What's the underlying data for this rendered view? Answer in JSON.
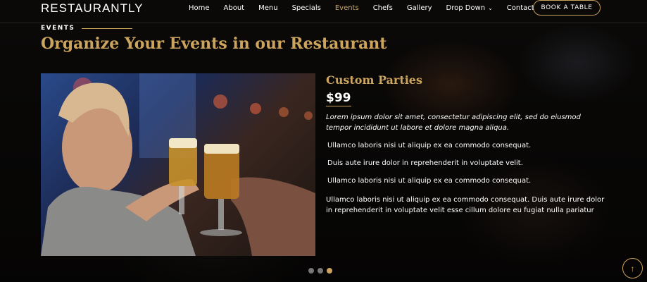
{
  "header": {
    "logo": "RESTAURANTLY",
    "nav": [
      {
        "label": "Home"
      },
      {
        "label": "About"
      },
      {
        "label": "Menu"
      },
      {
        "label": "Specials"
      },
      {
        "label": "Events"
      },
      {
        "label": "Chefs"
      },
      {
        "label": "Gallery"
      },
      {
        "label": "Drop Down"
      },
      {
        "label": "Contact"
      }
    ],
    "active_nav": "Events",
    "book_button": "BOOK A TABLE"
  },
  "section": {
    "label": "EVENTS",
    "title": "Organize Your Events in our Restaurant"
  },
  "event": {
    "title": "Custom Parties",
    "price": "$99",
    "intro": "Lorem ipsum dolor sit amet, consectetur adipiscing elit, sed do eiusmod tempor incididunt ut labore et dolore magna aliqua.",
    "bullets": [
      "Ullamco laboris nisi ut aliquip ex ea commodo consequat.",
      "Duis aute irure dolor in reprehenderit in voluptate velit.",
      "Ullamco laboris nisi ut aliquip ex ea commodo consequat."
    ],
    "description": "Ullamco laboris nisi ut aliquip ex ea commodo consequat. Duis aute irure dolor in reprehenderit in voluptate velit esse cillum dolore eu fugiat nulla pariatur"
  },
  "carousel": {
    "active_index": 2,
    "count": 3
  },
  "colors": {
    "accent": "#cda45e",
    "background": "#0c0b09"
  },
  "icons": {
    "back_to_top": "arrow-up-icon",
    "dropdown": "chevron-down-icon"
  }
}
